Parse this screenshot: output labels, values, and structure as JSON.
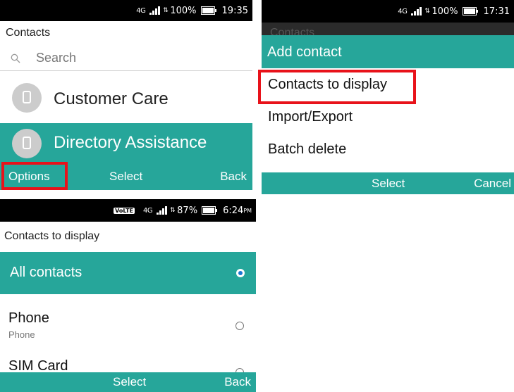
{
  "screen1": {
    "status": {
      "network": "4G",
      "battery": "100%",
      "time": "19:35"
    },
    "title": "Contacts",
    "search": {
      "placeholder": "Search"
    },
    "contacts": [
      {
        "name": "Customer Care",
        "selected": false
      },
      {
        "name": "Directory Assistance",
        "selected": true
      }
    ],
    "softkeys": {
      "left": "Options",
      "center": "Select",
      "right": "Back"
    }
  },
  "screen2": {
    "status": {
      "network": "4G",
      "battery": "100%",
      "time": "17:31"
    },
    "background_title": "Contacts",
    "menu": [
      {
        "label": "Add contact",
        "selected": true
      },
      {
        "label": "Contacts to display",
        "selected": false
      },
      {
        "label": "Import/Export",
        "selected": false
      },
      {
        "label": "Batch delete",
        "selected": false
      }
    ],
    "softkeys": {
      "center": "Select",
      "right": "Cancel"
    }
  },
  "screen3": {
    "status": {
      "volte": "VoLTE",
      "network": "4G",
      "battery": "87%",
      "time": "6:24",
      "ampm": "PM"
    },
    "title": "Contacts to display",
    "options": [
      {
        "label": "All contacts",
        "sub": "",
        "checked": true
      },
      {
        "label": "Phone",
        "sub": "Phone",
        "checked": false
      },
      {
        "label": "SIM Card",
        "sub": "",
        "checked": false
      }
    ],
    "softkeys": {
      "center": "Select",
      "right": "Back"
    }
  },
  "colors": {
    "accent": "#26a69a",
    "highlight": "#e8121a",
    "statusbar": "#000000"
  }
}
